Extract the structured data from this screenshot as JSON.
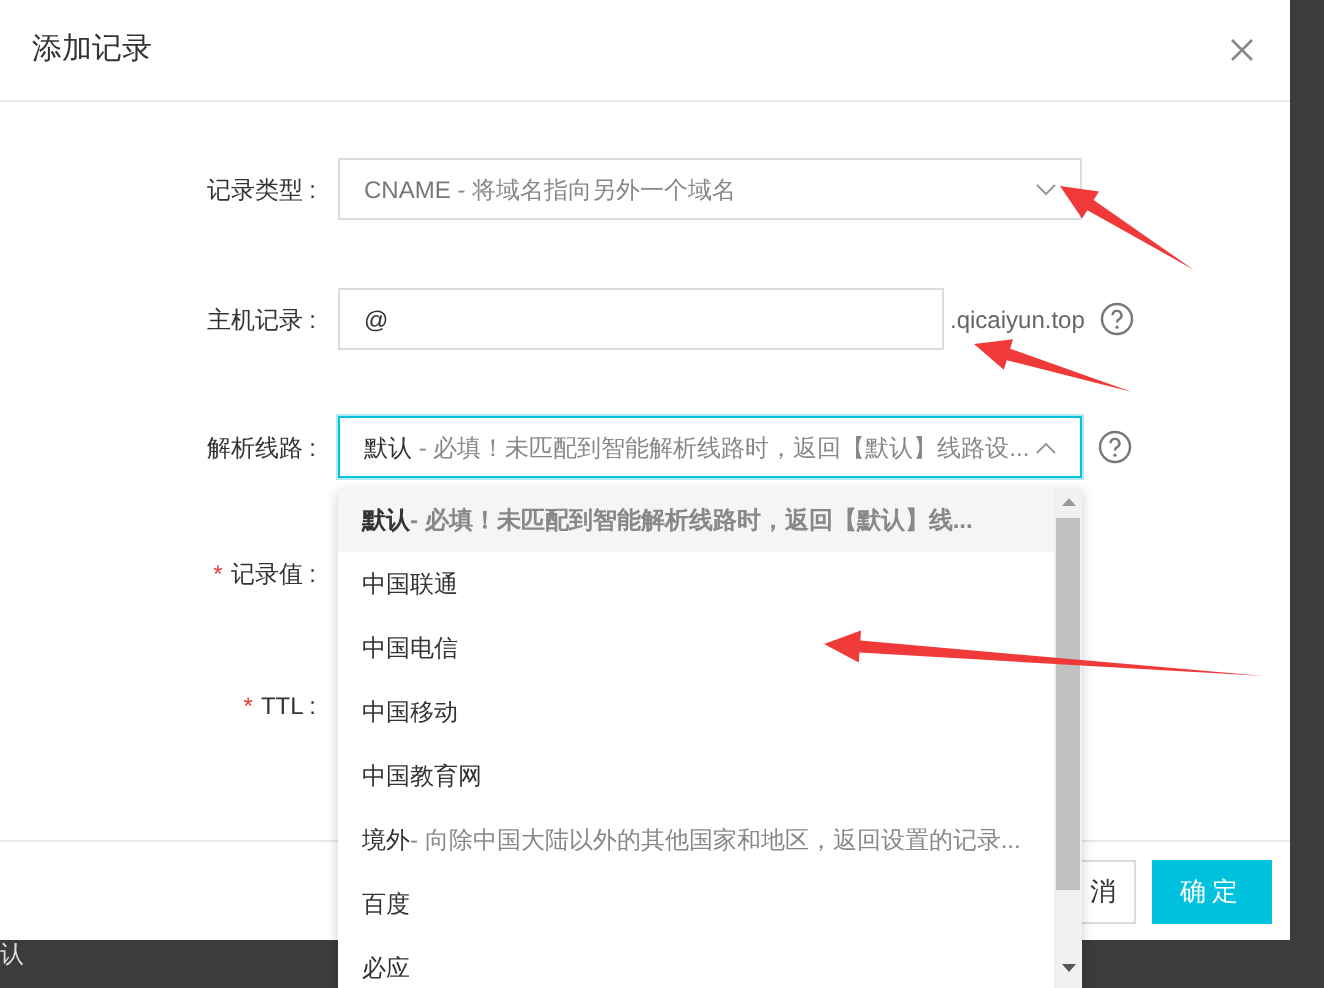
{
  "dialog": {
    "title": "添加记录"
  },
  "fields": [
    {
      "kind": "select",
      "label": "记录类型 :",
      "value_main": "CNAME",
      "value_note": "- 将域名指向另外一个域名",
      "open": false
    },
    {
      "kind": "input",
      "label": "主机记录 :",
      "value": "@",
      "suffix": ".qicaiyun.top",
      "help": true
    },
    {
      "kind": "select",
      "label": "解析线路 :",
      "value_main": "默认",
      "value_note": "- 必填！未匹配到智能解析线路时，返回【默认】线路设...",
      "open": true,
      "help": true
    },
    {
      "kind": "covered",
      "label": "记录值 :",
      "required_mark": "*"
    },
    {
      "kind": "covered",
      "label": "TTL :",
      "required_mark": "*"
    }
  ],
  "dropdown": {
    "options": [
      {
        "label": "默认",
        "note": "- 必填！未匹配到智能解析线路时，返回【默认】线...",
        "selected": true
      },
      {
        "label": "中国联通",
        "selected": false
      },
      {
        "label": "中国电信",
        "selected": false
      },
      {
        "label": "中国移动",
        "selected": false
      },
      {
        "label": "中国教育网",
        "selected": false
      },
      {
        "label": "境外",
        "note": "- 向除中国大陆以外的其他国家和地区，返回设置的记录...",
        "selected": false
      },
      {
        "label": "百度",
        "selected": false
      },
      {
        "label": "必应",
        "selected": false
      }
    ]
  },
  "buttons": [
    {
      "kind": "secondary",
      "label": "消"
    },
    {
      "kind": "primary",
      "label": "确定"
    }
  ],
  "background_text": "认"
}
